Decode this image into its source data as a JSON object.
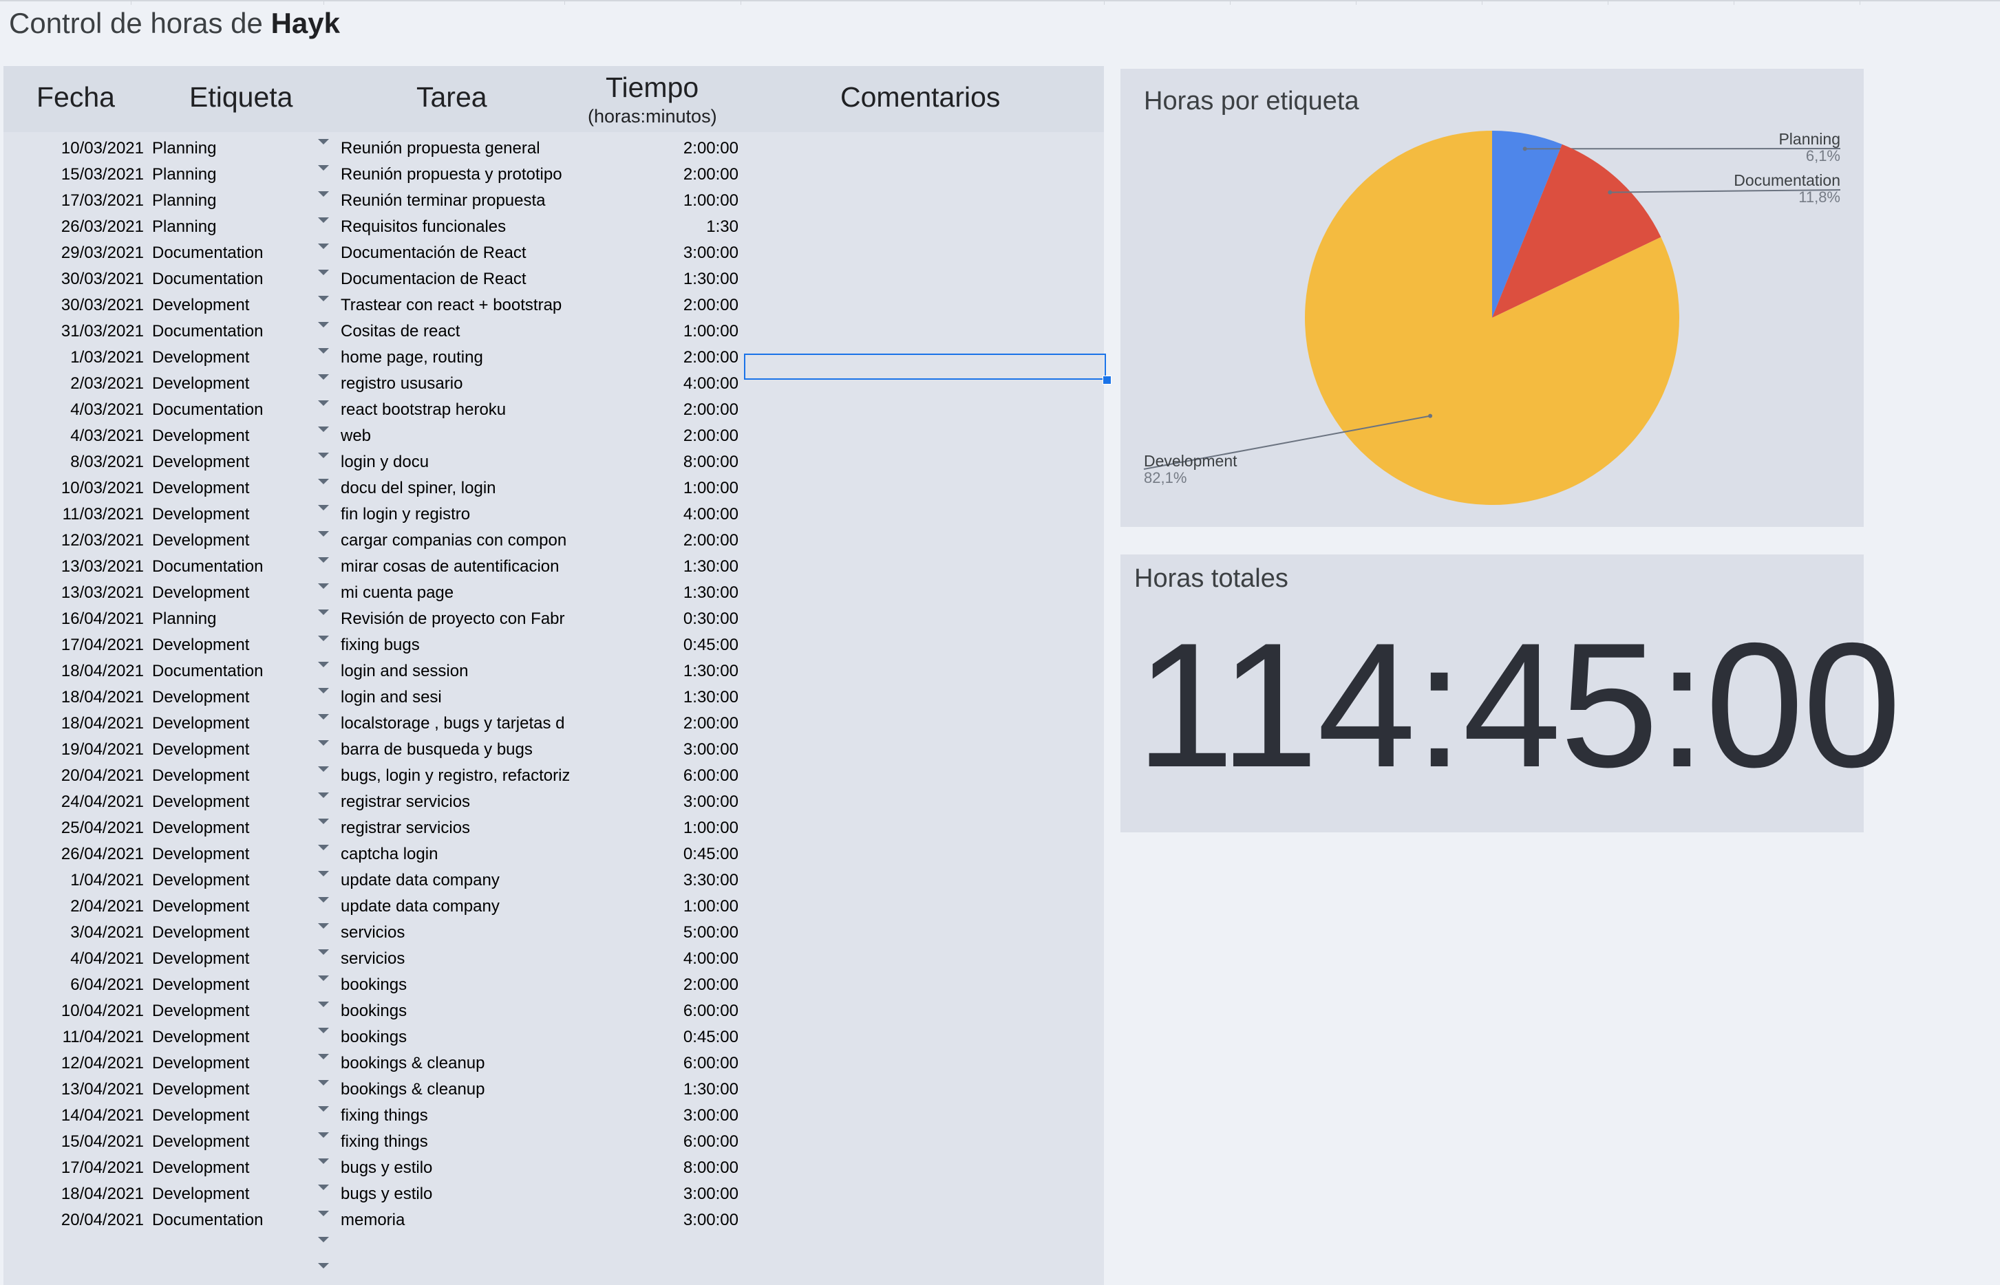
{
  "sheet": {
    "title_prefix": "Control de horas de",
    "title_name": "Hayk"
  },
  "table": {
    "headers": {
      "fecha": "Fecha",
      "etiqueta": "Etiqueta",
      "tarea": "Tarea",
      "tiempo": "Tiempo",
      "tiempo_sub": "(horas:minutos)",
      "comentarios": "Comentarios"
    },
    "rows": [
      {
        "fecha": "10/03/2021",
        "etiqueta": "Planning",
        "tarea": "Reunión propuesta general",
        "tiempo": "2:00:00"
      },
      {
        "fecha": "15/03/2021",
        "etiqueta": "Planning",
        "tarea": "Reunión propuesta y prototipo",
        "tiempo": "2:00:00"
      },
      {
        "fecha": "17/03/2021",
        "etiqueta": "Planning",
        "tarea": "Reunión terminar propuesta",
        "tiempo": "1:00:00"
      },
      {
        "fecha": "26/03/2021",
        "etiqueta": "Planning",
        "tarea": "Requisitos funcionales",
        "tiempo": "1:30"
      },
      {
        "fecha": "29/03/2021",
        "etiqueta": "Documentation",
        "tarea": "Documentación de React",
        "tiempo": "3:00:00"
      },
      {
        "fecha": "30/03/2021",
        "etiqueta": "Documentation",
        "tarea": "Documentacion de React",
        "tiempo": "1:30:00"
      },
      {
        "fecha": "30/03/2021",
        "etiqueta": "Development",
        "tarea": "Trastear con react + bootstrap",
        "tiempo": "2:00:00"
      },
      {
        "fecha": "31/03/2021",
        "etiqueta": "Documentation",
        "tarea": "Cositas de react",
        "tiempo": "1:00:00"
      },
      {
        "fecha": "1/03/2021",
        "etiqueta": "Development",
        "tarea": "home page, routing",
        "tiempo": "2:00:00"
      },
      {
        "fecha": "2/03/2021",
        "etiqueta": "Development",
        "tarea": "registro ususario",
        "tiempo": "4:00:00"
      },
      {
        "fecha": "4/03/2021",
        "etiqueta": "Documentation",
        "tarea": "react bootstrap heroku",
        "tiempo": "2:00:00"
      },
      {
        "fecha": "4/03/2021",
        "etiqueta": "Development",
        "tarea": "web",
        "tiempo": "2:00:00"
      },
      {
        "fecha": "8/03/2021",
        "etiqueta": "Development",
        "tarea": "login y docu",
        "tiempo": "8:00:00"
      },
      {
        "fecha": "10/03/2021",
        "etiqueta": "Development",
        "tarea": "docu del spiner, login",
        "tiempo": "1:00:00"
      },
      {
        "fecha": "11/03/2021",
        "etiqueta": "Development",
        "tarea": "fin login y registro",
        "tiempo": "4:00:00"
      },
      {
        "fecha": "12/03/2021",
        "etiqueta": "Development",
        "tarea": "cargar companias con compon",
        "tiempo": "2:00:00"
      },
      {
        "fecha": "13/03/2021",
        "etiqueta": "Documentation",
        "tarea": "mirar cosas de autentificacion",
        "tiempo": "1:30:00"
      },
      {
        "fecha": "13/03/2021",
        "etiqueta": "Development",
        "tarea": "mi cuenta page",
        "tiempo": "1:30:00"
      },
      {
        "fecha": "16/04/2021",
        "etiqueta": "Planning",
        "tarea": "Revisión de proyecto con Fabr",
        "tiempo": "0:30:00"
      },
      {
        "fecha": "17/04/2021",
        "etiqueta": "Development",
        "tarea": "fixing bugs",
        "tiempo": "0:45:00"
      },
      {
        "fecha": "18/04/2021",
        "etiqueta": "Documentation",
        "tarea": "login and session",
        "tiempo": "1:30:00"
      },
      {
        "fecha": "18/04/2021",
        "etiqueta": "Development",
        "tarea": "login and sesi",
        "tiempo": "1:30:00"
      },
      {
        "fecha": "18/04/2021",
        "etiqueta": "Development",
        "tarea": "localstorage , bugs y tarjetas d",
        "tiempo": "2:00:00"
      },
      {
        "fecha": "19/04/2021",
        "etiqueta": "Development",
        "tarea": "barra de busqueda y bugs",
        "tiempo": "3:00:00"
      },
      {
        "fecha": "20/04/2021",
        "etiqueta": "Development",
        "tarea": "bugs, login y registro, refactoriz",
        "tiempo": "6:00:00"
      },
      {
        "fecha": "24/04/2021",
        "etiqueta": "Development",
        "tarea": "registrar servicios",
        "tiempo": "3:00:00"
      },
      {
        "fecha": "25/04/2021",
        "etiqueta": "Development",
        "tarea": "registrar servicios",
        "tiempo": "1:00:00"
      },
      {
        "fecha": "26/04/2021",
        "etiqueta": "Development",
        "tarea": "captcha login",
        "tiempo": "0:45:00"
      },
      {
        "fecha": "1/04/2021",
        "etiqueta": "Development",
        "tarea": "update data company",
        "tiempo": "3:30:00"
      },
      {
        "fecha": "2/04/2021",
        "etiqueta": "Development",
        "tarea": "update data company",
        "tiempo": "1:00:00"
      },
      {
        "fecha": "3/04/2021",
        "etiqueta": "Development",
        "tarea": "servicios",
        "tiempo": "5:00:00"
      },
      {
        "fecha": "4/04/2021",
        "etiqueta": "Development",
        "tarea": "servicios",
        "tiempo": "4:00:00"
      },
      {
        "fecha": "6/04/2021",
        "etiqueta": "Development",
        "tarea": "bookings",
        "tiempo": "2:00:00"
      },
      {
        "fecha": "10/04/2021",
        "etiqueta": "Development",
        "tarea": "bookings",
        "tiempo": "6:00:00"
      },
      {
        "fecha": "11/04/2021",
        "etiqueta": "Development",
        "tarea": "bookings",
        "tiempo": "0:45:00"
      },
      {
        "fecha": "12/04/2021",
        "etiqueta": "Development",
        "tarea": "bookings & cleanup",
        "tiempo": "6:00:00"
      },
      {
        "fecha": "13/04/2021",
        "etiqueta": "Development",
        "tarea": "bookings & cleanup",
        "tiempo": "1:30:00"
      },
      {
        "fecha": "14/04/2021",
        "etiqueta": "Development",
        "tarea": "fixing things",
        "tiempo": "3:00:00"
      },
      {
        "fecha": "15/04/2021",
        "etiqueta": "Development",
        "tarea": "fixing things",
        "tiempo": "6:00:00"
      },
      {
        "fecha": "17/04/2021",
        "etiqueta": "Development",
        "tarea": "bugs y estilo",
        "tiempo": "8:00:00"
      },
      {
        "fecha": "18/04/2021",
        "etiqueta": "Development",
        "tarea": "bugs y estilo",
        "tiempo": "3:00:00"
      },
      {
        "fecha": "20/04/2021",
        "etiqueta": "Documentation",
        "tarea": "memoria",
        "tiempo": "3:00:00"
      },
      {
        "fecha": "",
        "etiqueta": "",
        "tarea": "",
        "tiempo": ""
      },
      {
        "fecha": "",
        "etiqueta": "",
        "tarea": "",
        "tiempo": ""
      }
    ]
  },
  "chart_data": {
    "type": "pie",
    "title": "Horas por etiqueta",
    "categories": [
      "Planning",
      "Documentation",
      "Development"
    ],
    "values": [
      6.1,
      11.8,
      82.1
    ],
    "value_labels": [
      "6,1%",
      "11,8%",
      "82,1%"
    ],
    "colors": [
      "#4e86ea",
      "#dc4f3f",
      "#f4bb40"
    ],
    "legend": "labels beside slices"
  },
  "total": {
    "title": "Horas totales",
    "value": "114:45:00"
  },
  "colors": {
    "background": "#eef1f6",
    "panel": "#dfe3eb",
    "selection": "#1a73e8"
  }
}
